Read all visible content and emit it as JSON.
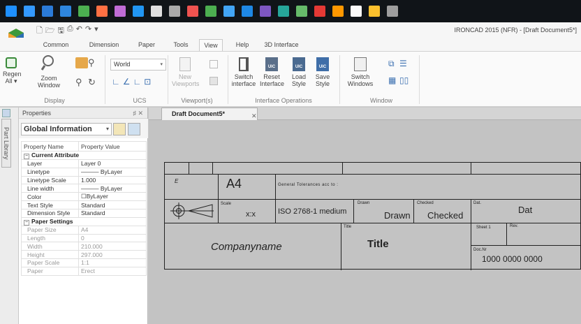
{
  "taskbar": {
    "icon_colors": [
      "#1e90ff",
      "#3399ff",
      "#2b7bd8",
      "#2e86de",
      "#4caf50",
      "#ff7043",
      "#c06cd6",
      "#2196f3",
      "#e0e0e0",
      "#aaaaaa",
      "#ef5350",
      "#4caf50",
      "#42a5f5",
      "#1e88e5",
      "#7e57c2",
      "#26a69a",
      "#66bb6a",
      "#e53935",
      "#ff9800",
      "#fafafa",
      "#fbc02d",
      "#9e9e9e"
    ]
  },
  "window": {
    "title": "IRONCAD 2015 (NFR) - [Draft Document5*]"
  },
  "tabs": [
    {
      "label": "Common"
    },
    {
      "label": "Dimension"
    },
    {
      "label": "Paper"
    },
    {
      "label": "Tools"
    },
    {
      "label": "View"
    },
    {
      "label": "Help"
    },
    {
      "label": "3D Interface"
    }
  ],
  "ribbon": {
    "regen": "Regen All",
    "regen_arrow": "▾",
    "zoom": "Zoom Window",
    "ucs_select": "World",
    "new_viewports": "New Viewports",
    "switch_interface": "Switch interface",
    "reset_interface": "Reset Interface",
    "load_style": "Load Style",
    "save_style": "Save Style",
    "switch_windows": "Switch Windows",
    "groups": {
      "display": "Display",
      "ucs": "UCS",
      "viewports": "Viewport(s)",
      "interface_ops": "Interface Operations",
      "window": "Window"
    }
  },
  "sidebar": {
    "part_library": "Part Library"
  },
  "properties": {
    "title": "Properties",
    "controls": "♯ ✕",
    "selector": "Global Information",
    "col_name": "Property Name",
    "col_value": "Property Value",
    "sections": [
      {
        "name": "Current Attribute",
        "rows": [
          [
            "Layer",
            "Layer 0"
          ],
          [
            "Linetype",
            "——— ByLayer"
          ],
          [
            "Linetype Scale",
            "1.000"
          ],
          [
            "Line width",
            "——— ByLayer"
          ],
          [
            "Color",
            "☐ByLayer"
          ],
          [
            "Text Style",
            "Standard"
          ],
          [
            "Dimension Style",
            "Standard"
          ]
        ]
      },
      {
        "name": "Paper Settings",
        "rows": [
          [
            "Paper Size",
            "A4"
          ],
          [
            "Length",
            "0"
          ],
          [
            "Width",
            "210.000"
          ],
          [
            "Height",
            "297.000"
          ],
          [
            "Paper Scale",
            "1:1"
          ],
          [
            "Paper",
            "Erect"
          ]
        ]
      }
    ]
  },
  "document": {
    "tab": "Draft Document5*",
    "close": "✕"
  },
  "titleblock": {
    "e": "E",
    "size": "A4",
    "tolerances": "General Tolerances acc to :",
    "scale_label": "Scale",
    "scale_value": "x:x",
    "standard": "ISO 2768-1 medium",
    "drawn_label": "Drawn",
    "drawn_value": "Drawn",
    "checked_label": "Checked",
    "checked_value": "Checked",
    "dat_label": "Dat.",
    "dat_value": "Dat",
    "company": "Companyname",
    "title_label": "Title",
    "title_value": "Title",
    "sheet": "Sheet 1",
    "rev": "Rev.",
    "docnr_label": "Doc.Nr",
    "docnr_value": "1000 0000 0000"
  }
}
